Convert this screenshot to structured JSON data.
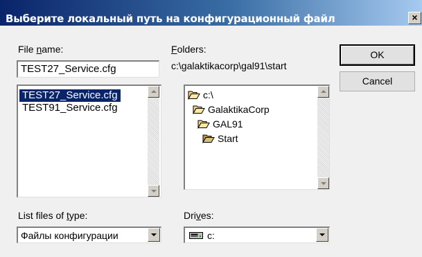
{
  "window": {
    "title": "Выберите локальный путь на конфигурационный файл",
    "close_glyph": "×"
  },
  "file_name": {
    "label_pre": "File ",
    "label_underlined": "n",
    "label_post": "ame:",
    "value": "TEST27_Service.cfg"
  },
  "file_list": {
    "items": [
      {
        "label": "TEST27_Service.cfg",
        "selected": true
      },
      {
        "label": "TEST91_Service.cfg",
        "selected": false
      }
    ]
  },
  "folders": {
    "label_underlined": "F",
    "label_post": "olders:",
    "current_path": "c:\\galaktikacorp\\gal91\\start",
    "tree": [
      {
        "label": "c:\\",
        "icon": "open-folder-icon",
        "level": 0
      },
      {
        "label": "GalaktikaCorp",
        "icon": "open-folder-icon",
        "level": 1
      },
      {
        "label": "GAL91",
        "icon": "open-folder-icon",
        "level": 2
      },
      {
        "label": "Start",
        "icon": "open-folder-icon",
        "level": 3
      }
    ]
  },
  "buttons": {
    "ok": "OK",
    "cancel": "Cancel"
  },
  "file_type": {
    "label_pre": "List files of ",
    "label_underlined": "t",
    "label_post": "ype:",
    "value": "Файлы конфигурации"
  },
  "drives": {
    "label_pre": "Dri",
    "label_underlined": "v",
    "label_post": "es:",
    "value": "c:",
    "icon": "drive-icon"
  },
  "colors": {
    "selection": "#0a246a",
    "title_gradient_start": "#0a246a",
    "title_gradient_end": "#a6caf0"
  }
}
